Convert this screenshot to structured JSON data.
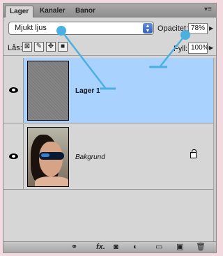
{
  "tabs": [
    {
      "label": "Lager",
      "active": true
    },
    {
      "label": "Kanaler",
      "active": false
    },
    {
      "label": "Banor",
      "active": false
    }
  ],
  "panel_menu_icon": "panel-menu-icon",
  "blend": {
    "value": "Mjukt ljus"
  },
  "opacity": {
    "label": "Opacitet:",
    "value": "78%"
  },
  "lock": {
    "label": "Lås:",
    "icons": [
      "lock-transparent-icon",
      "lock-image-icon",
      "lock-position-icon",
      "lock-all-icon"
    ]
  },
  "fill": {
    "label": "Fyll:",
    "value": "100%"
  },
  "layers": [
    {
      "name": "Lager 1",
      "selected": true,
      "visible": true
    },
    {
      "name": "Bakgrund",
      "selected": false,
      "visible": true,
      "locked": true
    }
  ],
  "bottom_icons": [
    "link-icon",
    "fx-icon",
    "mask-icon",
    "adjustment-icon",
    "folder-icon",
    "new-layer-icon",
    "trash-icon"
  ],
  "bottom_fx_label": "fx.",
  "colors": {
    "selection": "#a9d2ff",
    "annotation": "#4ab0e0",
    "background": "#f3d9e0"
  }
}
